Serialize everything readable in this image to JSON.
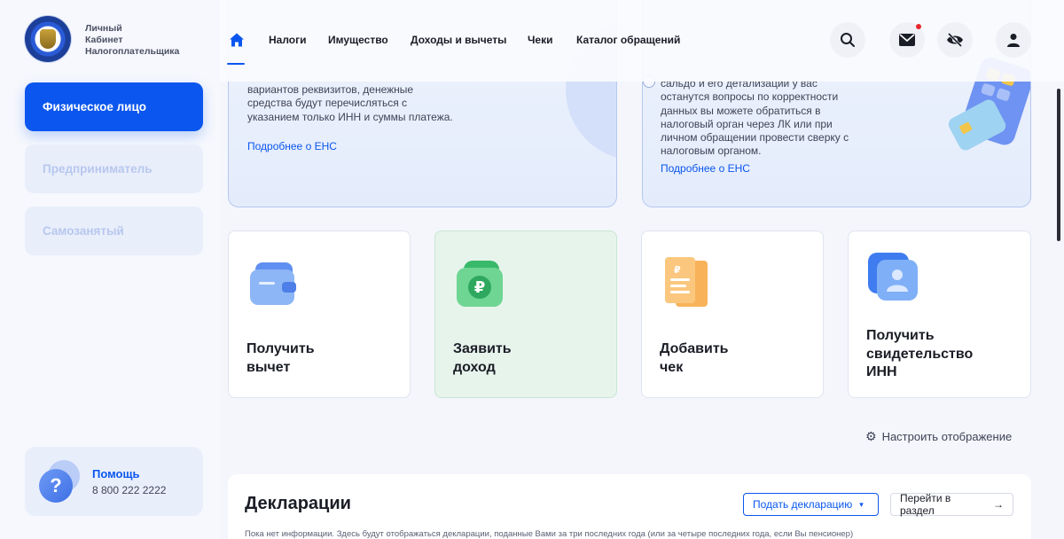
{
  "logo": {
    "line1": "Личный",
    "line2": "Кабинет",
    "line3": "Налогоплательщика"
  },
  "sidebar": {
    "items": [
      {
        "label": "Физическое лицо"
      },
      {
        "label": "Предприниматель"
      },
      {
        "label": "Самозанятый"
      }
    ],
    "help": {
      "title": "Помощь",
      "phone": "8 800 222 2222",
      "icon": "question-icon"
    }
  },
  "nav": {
    "items": [
      "Налоги",
      "Имущество",
      "Доходы и вычеты",
      "Чеки",
      "Каталог обращений"
    ],
    "icons": [
      "home-icon",
      "search-icon",
      "mail-icon",
      "eye-off-icon",
      "user-icon"
    ]
  },
  "info_left": {
    "lines": [
      "вариантов реквизитов, денежные",
      "средства будут перечисляться с",
      "указанием только ИНН и суммы платежа."
    ],
    "link": "Подробнее о ЕНС"
  },
  "info_right": {
    "lines": [
      "сальдо и его детализации у вас",
      "останутся вопросы по корректности",
      "данных вы можете обратиться в",
      "налоговый орган через ЛК или при",
      "личном обращении провести сверку с",
      "налоговым органом."
    ],
    "link": "Подробнее о ЕНС"
  },
  "actions": [
    {
      "line1": "Получить",
      "line2": "вычет",
      "line3": ""
    },
    {
      "line1": "Заявить",
      "line2": "доход",
      "line3": ""
    },
    {
      "line1": "Добавить",
      "line2": "чек",
      "line3": ""
    },
    {
      "line1": "Получить",
      "line2": "свидетельство",
      "line3": "ИНН"
    }
  ],
  "settings": {
    "label": "Настроить отображение",
    "icon": "gear-icon"
  },
  "declarations": {
    "title": "Декларации",
    "submit": "Подать декларацию",
    "goto": "Перейти в раздел",
    "note": "Пока нет информации. Здесь будут отображаться декларации, поданные Вами за три последних года (или за четыре последних года, если Вы пенсионер)"
  },
  "colors": {
    "accent": "#0a56ee",
    "notification": "#e8272b",
    "green_card": "#e7f4ec"
  }
}
